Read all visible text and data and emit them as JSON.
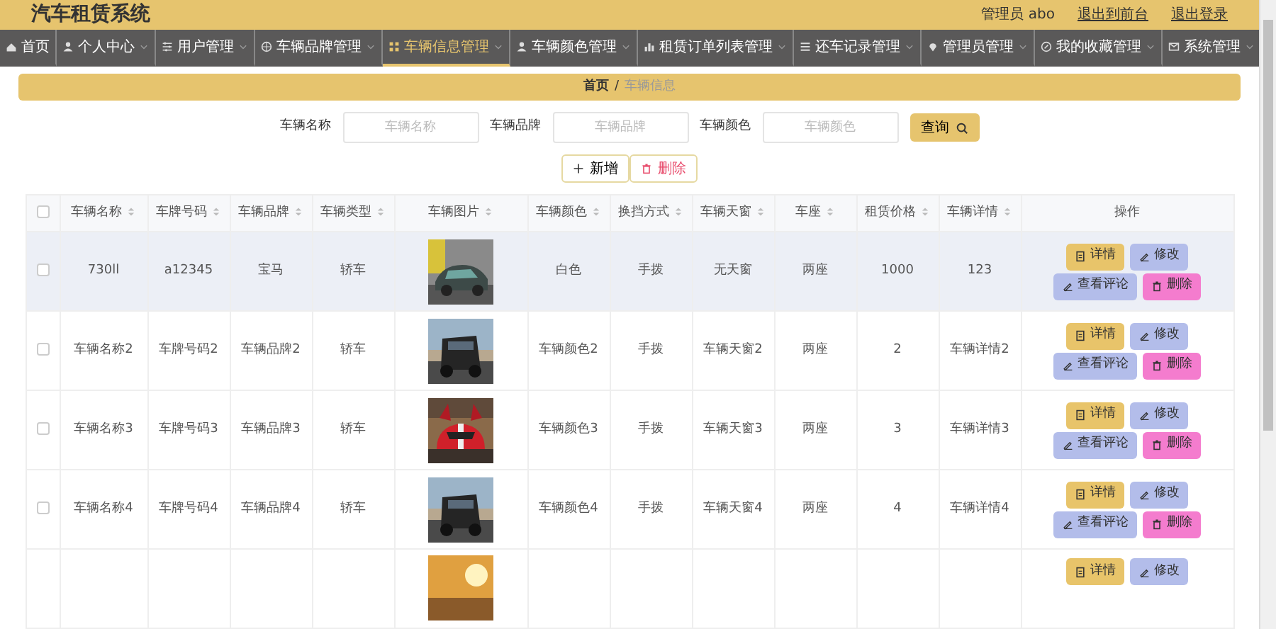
{
  "app": {
    "title": "汽车租赁系统",
    "user": "管理员 abo",
    "links": [
      "退出到前台",
      "退出登录"
    ]
  },
  "nav": [
    {
      "label": "首页",
      "dropdown": false,
      "selected": false
    },
    {
      "label": "个人中心",
      "dropdown": true,
      "selected": false
    },
    {
      "label": "用户管理",
      "dropdown": true,
      "selected": false
    },
    {
      "label": "车辆品牌管理",
      "dropdown": true,
      "selected": false
    },
    {
      "label": "车辆信息管理",
      "dropdown": true,
      "selected": true
    },
    {
      "label": "车辆颜色管理",
      "dropdown": true,
      "selected": false
    },
    {
      "label": "租赁订单列表管理",
      "dropdown": true,
      "selected": false
    },
    {
      "label": "还车记录管理",
      "dropdown": true,
      "selected": false
    },
    {
      "label": "管理员管理",
      "dropdown": true,
      "selected": false
    },
    {
      "label": "我的收藏管理",
      "dropdown": true,
      "selected": false
    },
    {
      "label": "系统管理",
      "dropdown": true,
      "selected": false
    }
  ],
  "breadcrumb": {
    "items": [
      {
        "label": "首页",
        "current": false
      },
      {
        "label": "车辆信息",
        "current": true
      }
    ],
    "separator": "/"
  },
  "search": {
    "fields": [
      {
        "label": "车辆名称",
        "placeholder": "车辆名称"
      },
      {
        "label": "车辆品牌",
        "placeholder": "车辆品牌"
      },
      {
        "label": "车辆颜色",
        "placeholder": "车辆颜色"
      }
    ],
    "button": "查询"
  },
  "toolbar": [
    {
      "label": "新增",
      "kind": "add"
    },
    {
      "label": "删除",
      "kind": "delete"
    }
  ],
  "table": {
    "select_all": {
      "checked": false
    },
    "columns": [
      {
        "label": "车辆名称",
        "kind": "text",
        "sortable": true
      },
      {
        "label": "车牌号码",
        "kind": "text",
        "sortable": true
      },
      {
        "label": "车辆品牌",
        "kind": "text",
        "sortable": true
      },
      {
        "label": "车辆类型",
        "kind": "text",
        "sortable": true
      },
      {
        "label": "车辆图片",
        "kind": "picture",
        "sortable": true
      },
      {
        "label": "车辆颜色",
        "kind": "text",
        "sortable": true
      },
      {
        "label": "换挡方式",
        "kind": "text",
        "sortable": true
      },
      {
        "label": "车辆天窗",
        "kind": "text",
        "sortable": true
      },
      {
        "label": "车座",
        "kind": "text",
        "sortable": true
      },
      {
        "label": "租赁价格",
        "kind": "text",
        "sortable": true
      },
      {
        "label": "车辆详情",
        "kind": "text",
        "sortable": true
      },
      {
        "label": "操作",
        "kind": "actions",
        "sortable": false
      }
    ],
    "rows": [
      {
        "checked": false,
        "highlighted": true,
        "cells": [
          "730ll",
          "a12345",
          "宝马",
          "轿车",
          "白色",
          "手拨",
          "无天窗",
          "两座",
          "1000",
          "123"
        ],
        "actions": [
          {
            "label": "详情",
            "kind": "detail"
          },
          {
            "label": "修改",
            "kind": "edit"
          },
          {
            "label": "查看评论",
            "kind": "review"
          },
          {
            "label": "删除",
            "kind": "delete"
          }
        ]
      },
      {
        "checked": false,
        "highlighted": false,
        "cells": [
          "车辆名称2",
          "车牌号码2",
          "车辆品牌2",
          "轿车",
          "车辆颜色2",
          "手拨",
          "车辆天窗2",
          "两座",
          "2",
          "车辆详情2"
        ],
        "actions": [
          {
            "label": "详情",
            "kind": "detail"
          },
          {
            "label": "修改",
            "kind": "edit"
          },
          {
            "label": "查看评论",
            "kind": "review"
          },
          {
            "label": "删除",
            "kind": "delete"
          }
        ]
      },
      {
        "checked": false,
        "highlighted": false,
        "cells": [
          "车辆名称3",
          "车牌号码3",
          "车辆品牌3",
          "轿车",
          "车辆颜色3",
          "手拨",
          "车辆天窗3",
          "两座",
          "3",
          "车辆详情3"
        ],
        "actions": [
          {
            "label": "详情",
            "kind": "detail"
          },
          {
            "label": "修改",
            "kind": "edit"
          },
          {
            "label": "查看评论",
            "kind": "review"
          },
          {
            "label": "删除",
            "kind": "delete"
          }
        ]
      },
      {
        "checked": false,
        "highlighted": false,
        "cells": [
          "车辆名称4",
          "车牌号码4",
          "车辆品牌4",
          "轿车",
          "车辆颜色4",
          "手拨",
          "车辆天窗4",
          "两座",
          "4",
          "车辆详情4"
        ],
        "actions": [
          {
            "label": "详情",
            "kind": "detail"
          },
          {
            "label": "修改",
            "kind": "edit"
          },
          {
            "label": "查看评论",
            "kind": "review"
          },
          {
            "label": "删除",
            "kind": "delete"
          }
        ]
      },
      {
        "actions": [
          {
            "label": "详情",
            "kind": "detail"
          },
          {
            "label": "修改",
            "kind": "edit"
          }
        ]
      }
    ]
  }
}
